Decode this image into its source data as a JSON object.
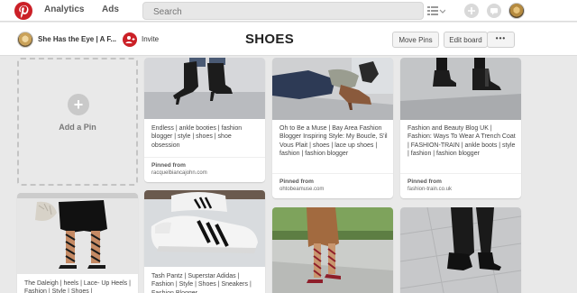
{
  "nav": {
    "analytics_label": "Analytics",
    "ads_label": "Ads",
    "search_placeholder": "Search"
  },
  "board": {
    "owner_name": "She Has the Eye | A F...",
    "invite_label": "Invite",
    "title": "SHOES",
    "move_pins_label": "Move Pins",
    "edit_board_label": "Edit board",
    "more_label": "•••"
  },
  "add_pin": {
    "plus": "+",
    "label": "Add a Pin"
  },
  "pins": [
    {
      "description": "Endless | ankle booties | fashion blogger | style | shoes | shoe obsession",
      "pinned_from_label": "Pinned from",
      "source": "racquelbiancajohn.com"
    },
    {
      "description": "Oh to Be a Muse | Bay Area Fashion Blogger Inspiring Style: My Boucle, S'il Vous Plait | shoes | lace up shoes | fashion | fashion blogger",
      "pinned_from_label": "Pinned from",
      "source": "ohtobeamuse.com"
    },
    {
      "description": "Fashion and Beauty Blog UK | Fashion: Ways To Wear A Trench Coat | FASHION-TRAIN | ankle boots | style | fashion | fashion blogger",
      "pinned_from_label": "Pinned from",
      "source": "fashion-train.co.uk"
    },
    {
      "description": "The Daleigh | heels | Lace- Up Heels | Fashion | Style | Shoes |"
    },
    {
      "description": "Tash Pantz | Superstar Adidas | Fashion | Style | Shoes | Sneakers | Fashion Blogger"
    }
  ],
  "colors": {
    "brand_red": "#cb2027",
    "background": "#e9e9e9"
  }
}
